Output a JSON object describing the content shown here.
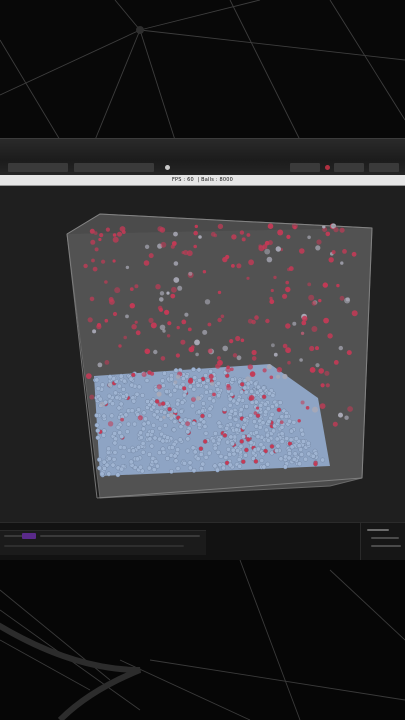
{
  "status_bar": {
    "fps_label": "FPS",
    "fps_value": "60",
    "balls_label": "Balls",
    "balls_value": "8000"
  },
  "colors": {
    "viewport_bg": "#1f1f1f",
    "container_face": "#5f5f5f",
    "settled_ball": "#9fb4d2",
    "active_ball": "#c43a56"
  },
  "simulation": {
    "container": "translucent-cube",
    "ball_count": 8000
  }
}
